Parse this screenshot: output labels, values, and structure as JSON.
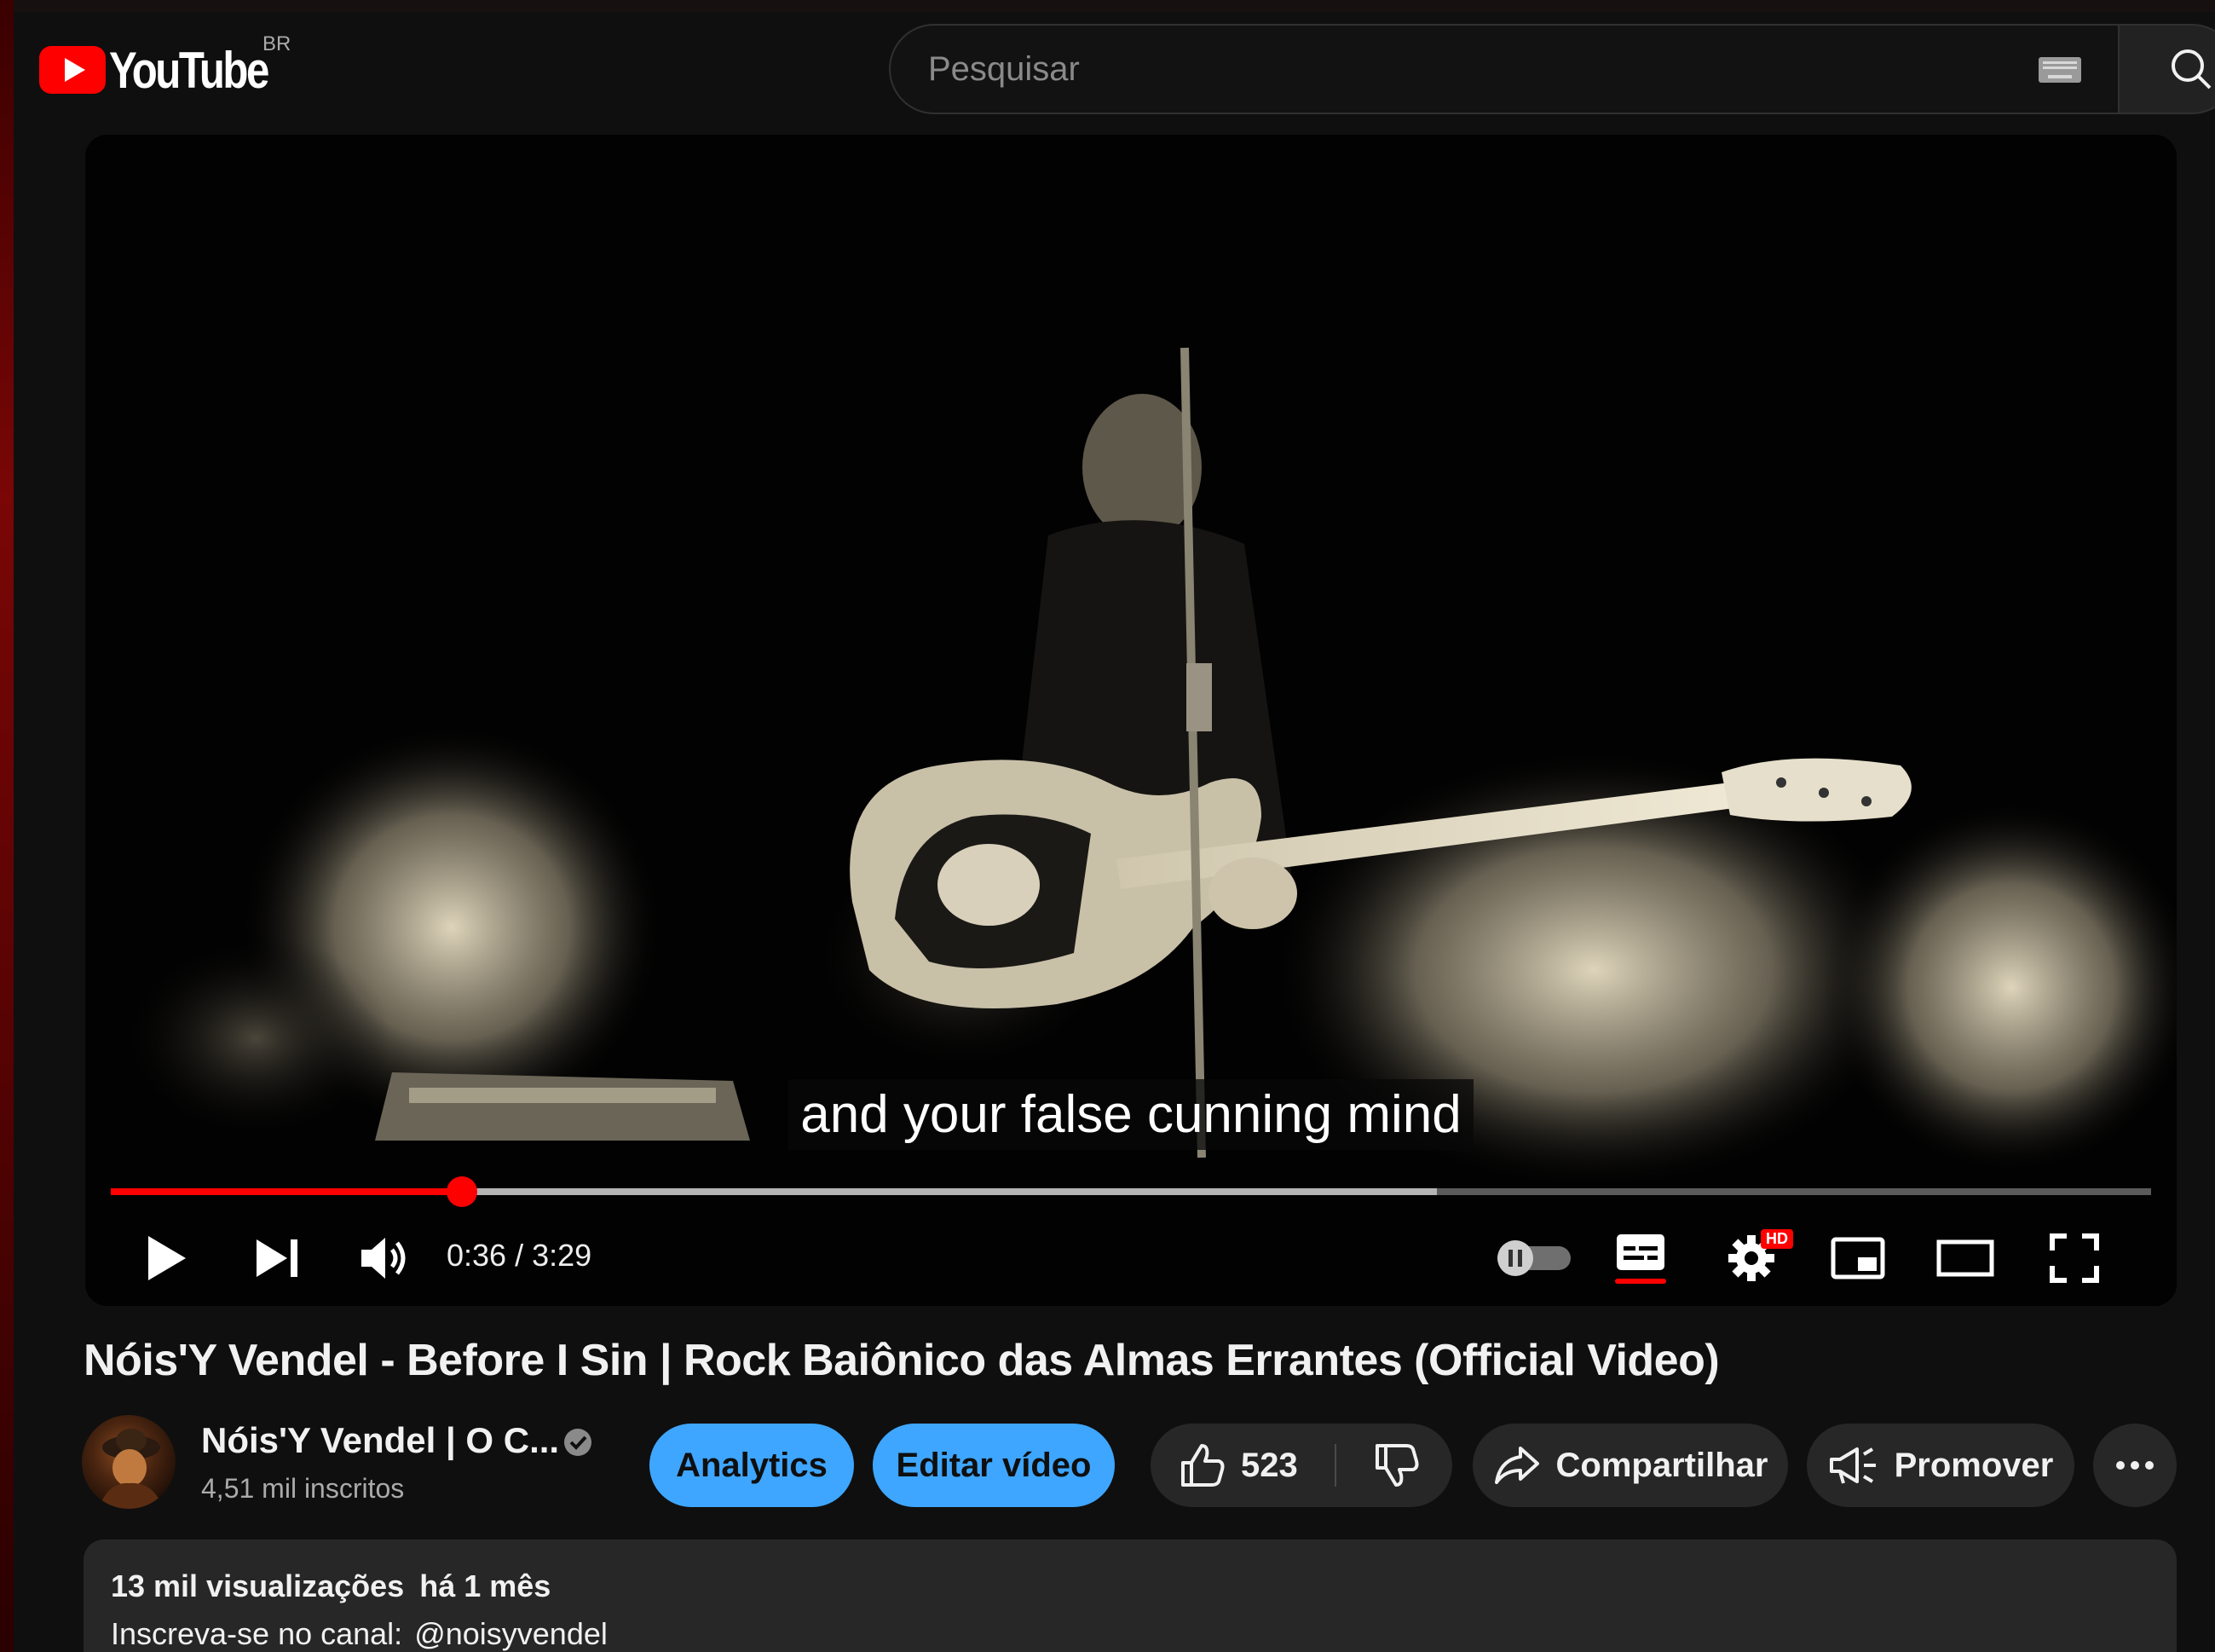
{
  "masthead": {
    "logo_text": "YouTube",
    "country_code": "BR",
    "search_placeholder": "Pesquisar"
  },
  "player": {
    "caption": "and your false cunning mind",
    "time_display": "0:36 / 3:29",
    "progress_fraction": 0.172,
    "settings_badge": "HD",
    "colors": {
      "accent": "#ff0000"
    }
  },
  "video": {
    "title": "Nóis'Y Vendel - Before I Sin | Rock Baiônico das Almas Errantes (Official Video)"
  },
  "channel": {
    "name": "Nóis'Y Vendel | O C...",
    "subscribers": "4,51 mil inscritos"
  },
  "actions": {
    "analytics_label": "Analytics",
    "edit_label": "Editar vídeo",
    "like_count": "523",
    "share_label": "Compartilhar",
    "promote_label": "Promover",
    "blue_color": "#3ea6ff"
  },
  "description": {
    "views": "13 mil visualizações",
    "age": "há 1 mês",
    "line1_prefix": "Inscreva-se no canal:",
    "line1_handle": "@noisyvendel"
  }
}
